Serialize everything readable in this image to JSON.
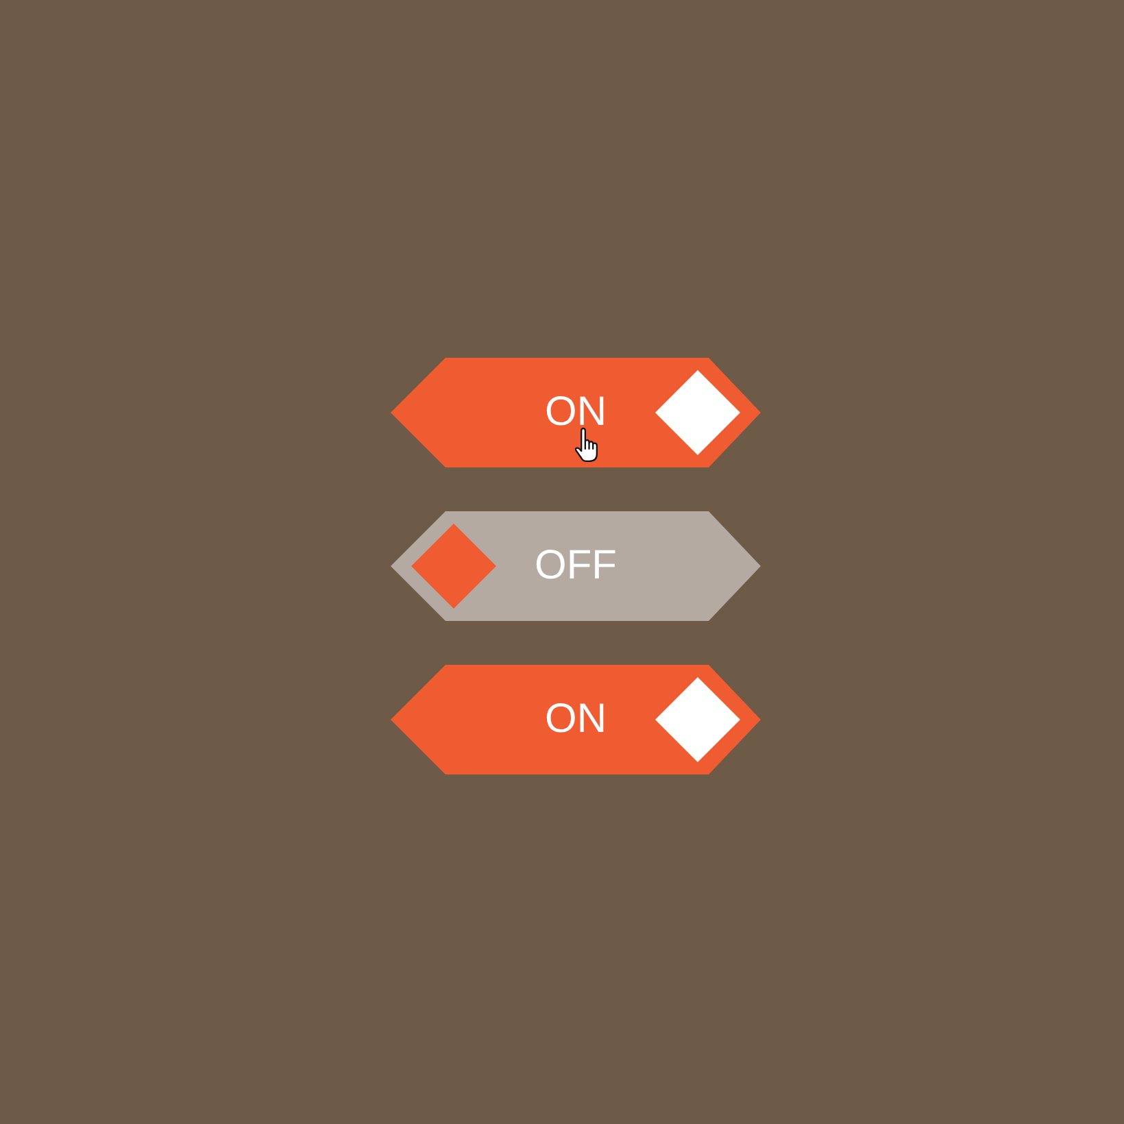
{
  "toggles": [
    {
      "label": "ON",
      "on": true,
      "hovered": true
    },
    {
      "label": "OFF",
      "on": false,
      "hovered": false
    },
    {
      "label": "ON",
      "on": true,
      "hovered": false
    }
  ]
}
